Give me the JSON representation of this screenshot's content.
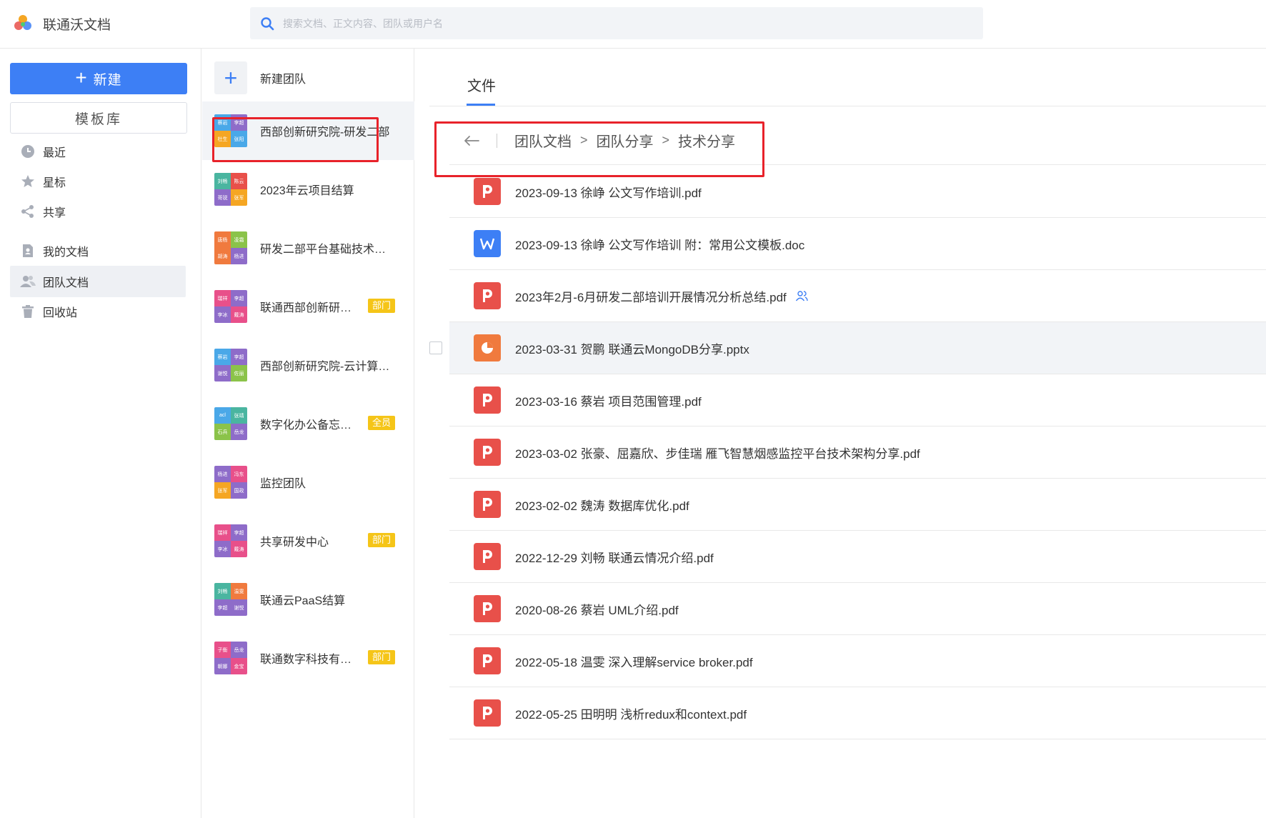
{
  "header": {
    "app_title": "联通沃文档",
    "search_placeholder": "搜索文档、正文内容、团队或用户名"
  },
  "sidebar": {
    "new_label": "新建",
    "template_label": "模板库",
    "nav": [
      {
        "label": "最近",
        "icon": "clock-icon"
      },
      {
        "label": "星标",
        "icon": "star-icon"
      },
      {
        "label": "共享",
        "icon": "share-icon"
      },
      {
        "label": "我的文档",
        "icon": "my-doc-icon"
      },
      {
        "label": "团队文档",
        "icon": "team-icon",
        "active": true
      },
      {
        "label": "回收站",
        "icon": "trash-icon"
      }
    ]
  },
  "teams": {
    "new_team_label": "新建团队",
    "items": [
      {
        "name": "西部创新研究院-研发二部",
        "members": [
          "蔡岩",
          "李超",
          "杜生",
          "张阳"
        ],
        "selected": true
      },
      {
        "name": "2023年云项目结算",
        "members": [
          "刘畅",
          "陈云",
          "哥锐",
          "张军"
        ]
      },
      {
        "name": "研发二部平台基础技术…",
        "members": [
          "唐杨",
          "凌霜",
          "胡涛",
          "杨进"
        ]
      },
      {
        "name": "联通西部创新研…",
        "members": [
          "瑞祥",
          "李超",
          "李冰",
          "戴涛"
        ],
        "badge": "部门"
      },
      {
        "name": "西部创新研究院-云计算…",
        "members": [
          "蔡岩",
          "李超",
          "谢悦",
          "佐丽"
        ]
      },
      {
        "name": "数字化办公备忘…",
        "members": [
          "acl",
          "张靖",
          "石兵",
          "岳龙"
        ],
        "badge": "全员"
      },
      {
        "name": "监控团队",
        "members": [
          "杨进",
          "冯东",
          "张军",
          "国政"
        ]
      },
      {
        "name": "共享研发中心",
        "members": [
          "瑞祥",
          "李超",
          "李冰",
          "戴涛"
        ],
        "badge": "部门"
      },
      {
        "name": "联通云PaaS结算",
        "members": [
          "刘畅",
          "温雯",
          "李超",
          "谢悦"
        ]
      },
      {
        "name": "联通数字科技有…",
        "members": [
          "子衡",
          "岳龙",
          "朝娜",
          "金宝"
        ],
        "badge": "部门"
      }
    ]
  },
  "main": {
    "tab_label": "文件",
    "breadcrumb": [
      "团队文档",
      "团队分享",
      "技术分享"
    ],
    "files": [
      {
        "name": "2023-09-13 徐峥 公文写作培训.pdf",
        "type": "pdf"
      },
      {
        "name": "2023-09-13 徐峥 公文写作培训 附：常用公文模板.doc",
        "type": "doc"
      },
      {
        "name": "2023年2月-6月研发二部培训开展情况分析总结.pdf",
        "type": "pdf",
        "shared": true
      },
      {
        "name": "2023-03-31 贺鹏 联通云MongoDB分享.pptx",
        "type": "ppt",
        "hover": true
      },
      {
        "name": "2023-03-16 蔡岩 项目范围管理.pdf",
        "type": "pdf"
      },
      {
        "name": "2023-03-02 张豪、屈嘉欣、步佳瑞 雁飞智慧烟感监控平台技术架构分享.pdf",
        "type": "pdf"
      },
      {
        "name": "2023-02-02 魏涛 数据库优化.pdf",
        "type": "pdf"
      },
      {
        "name": "2022-12-29 刘畅 联通云情况介绍.pdf",
        "type": "pdf"
      },
      {
        "name": "2020-08-26 蔡岩 UML介绍.pdf",
        "type": "pdf"
      },
      {
        "name": "2022-05-18 温雯 深入理解service broker.pdf",
        "type": "pdf"
      },
      {
        "name": "2022-05-25 田明明 浅析redux和context.pdf",
        "type": "pdf"
      }
    ]
  },
  "colors": {
    "accent": "#3d7ff5",
    "pdf": "#e8504a",
    "doc": "#3d7ff5",
    "ppt": "#f07a3e",
    "badge": "#f5c518",
    "highlight": "#e8222a"
  }
}
